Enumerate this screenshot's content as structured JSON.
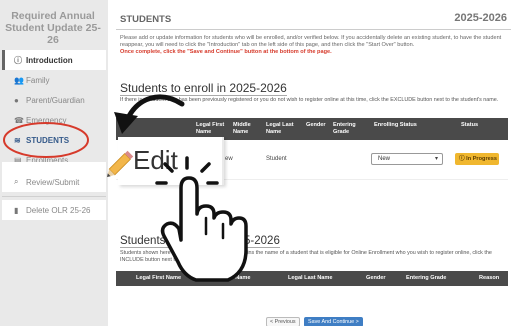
{
  "sidebar": {
    "title_line1": "Required Annual",
    "title_line2": "Student Update 25-",
    "title_line3": "26",
    "items": [
      {
        "label": "Introduction",
        "icon": "info-icon"
      },
      {
        "label": "Family",
        "icon": "family-icon"
      },
      {
        "label": "Parent/Guardian",
        "icon": "person-icon"
      },
      {
        "label": "Emergency",
        "icon": "phone-icon"
      },
      {
        "label": "STUDENTS",
        "icon": "graduation-cap-icon"
      },
      {
        "label": "Enrollments",
        "icon": "document-icon"
      },
      {
        "label": "Review/Submit",
        "icon": "search-icon"
      },
      {
        "label": "Delete OLR 25-26",
        "icon": "trash-icon"
      }
    ]
  },
  "header": {
    "title": "STUDENTS",
    "year": "2025-2026"
  },
  "intro": {
    "text": "Please add or update information for students who will be enrolled, and/or verified below. If you accidentally delete an existing student, to have the student reappear, you will need to click the \"Introduction\" tab on the left side of this page, and then click the \"Start Over\" button.",
    "red_text": "Once complete, click the \"Save and Continue\" button at the bottom of the page."
  },
  "section1": {
    "title": "Students to enroll in 2025-2026",
    "desc": "If there is a student who has been previously registered or you do not wish to register online at this time, click the EXCLUDE button next to the student's name.",
    "columns": [
      "Legal First Name",
      "Middle Name",
      "Legal Last Name",
      "Gender",
      "Entering Grade",
      "Enrolling Status",
      "Status"
    ],
    "row": {
      "first_name": "ew",
      "last_name": "Student",
      "enrolling_status": "New",
      "status": "In Progress"
    }
  },
  "section2": {
    "title": "Students to enroll in 2025-2026",
    "desc_line1": "Students shown here are not enrolled. If the list contains the name of a student that is eligible for Online Enrollment who you wish to register online, click the",
    "desc_line2": "INCLUDE button next to the student's name.",
    "columns": [
      "Legal First Name",
      "Middle Name",
      "Legal Last Name",
      "Gender",
      "Entering Grade",
      "Reason"
    ]
  },
  "nav": {
    "prev": "< Previous",
    "next": "Save And Continue >"
  },
  "overlay": {
    "edit_label": "Edit"
  },
  "colors": {
    "badge": "#f0b72f",
    "primary_button": "#3f7ec4",
    "highlight_circle": "#d63a2b",
    "header_bg": "#4a4a4a"
  }
}
